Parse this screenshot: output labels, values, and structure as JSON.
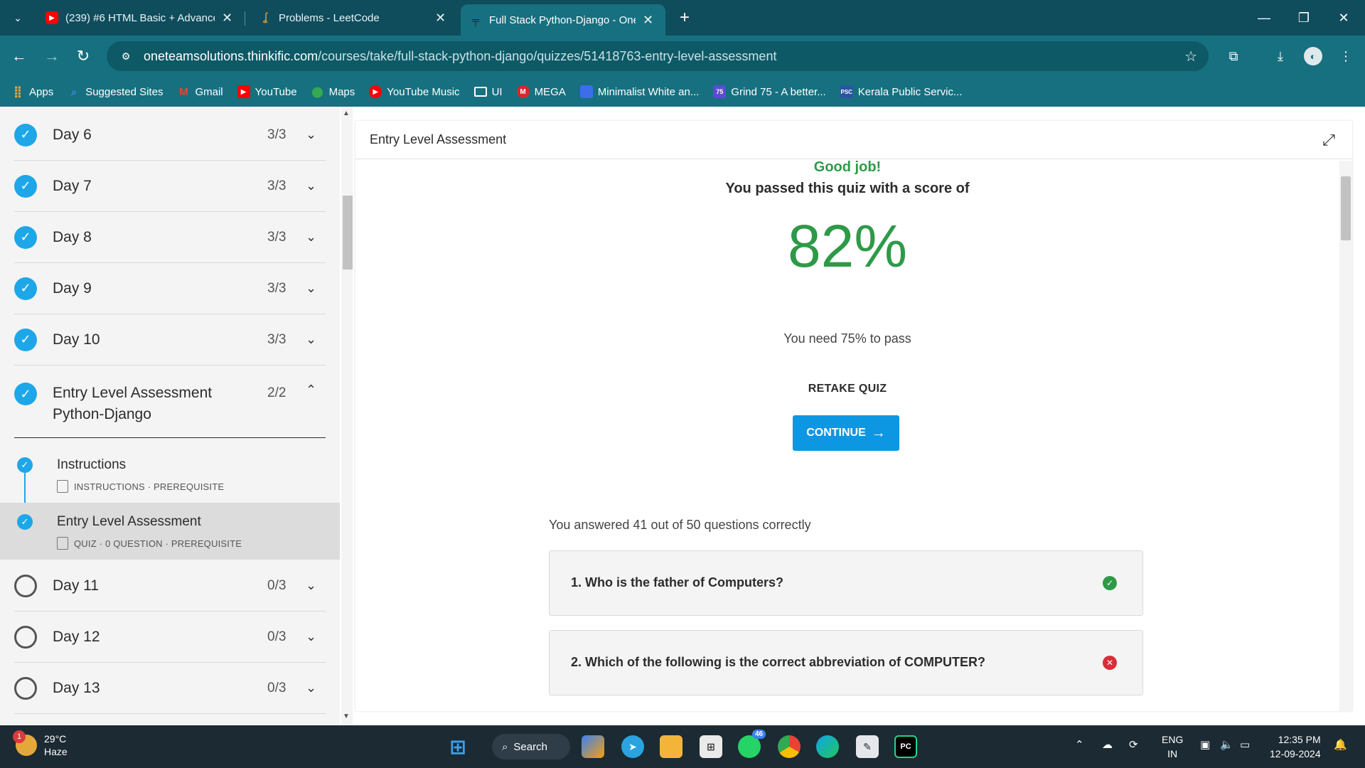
{
  "browser": {
    "tabs": [
      {
        "title": "(239) #6 HTML Basic + Advance",
        "favicon": "youtube-icon",
        "color": "#ff0000"
      },
      {
        "title": "Problems - LeetCode",
        "favicon": "leetcode-icon",
        "color": "#f0a23a"
      },
      {
        "title": "Full Stack Python-Django - One",
        "favicon": "thinkific-icon",
        "color": "#333333",
        "active": true
      }
    ],
    "url_domain": "oneteamsolutions.thinkific.com",
    "url_path": "/courses/take/full-stack-python-django/quizzes/51418763-entry-level-assessment",
    "bookmarks": [
      {
        "label": "Apps",
        "icon": "apps-grid-icon",
        "color": "#e8a33a"
      },
      {
        "label": "Suggested Sites",
        "icon": "suggested-icon",
        "color": "#3a8fd8"
      },
      {
        "label": "Gmail",
        "icon": "gmail-icon",
        "color": "#ea4335"
      },
      {
        "label": "YouTube",
        "icon": "youtube-icon",
        "color": "#ff0000"
      },
      {
        "label": "Maps",
        "icon": "maps-icon",
        "color": "#34a853"
      },
      {
        "label": "YouTube Music",
        "icon": "youtube-music-icon",
        "color": "#ff0000"
      },
      {
        "label": "UI",
        "icon": "folder-icon",
        "color": "#17707f"
      },
      {
        "label": "MEGA",
        "icon": "mega-icon",
        "color": "#d9272e"
      },
      {
        "label": "Minimalist White an...",
        "icon": "page-icon",
        "color": "#3b6ee8"
      },
      {
        "label": "Grind 75 - A better...",
        "icon": "grind75-icon",
        "color": "#5b4bd6"
      },
      {
        "label": "Kerala Public Servic...",
        "icon": "kpsc-icon",
        "color": "#2a55a0"
      }
    ]
  },
  "sidebar": {
    "days_top": [
      {
        "title": "Day 6",
        "count": "3/3"
      },
      {
        "title": "Day 7",
        "count": "3/3"
      },
      {
        "title": "Day 8",
        "count": "3/3"
      },
      {
        "title": "Day 9",
        "count": "3/3"
      },
      {
        "title": "Day 10",
        "count": "3/3"
      }
    ],
    "section": {
      "title_line1": "Entry Level Assessment",
      "title_line2": "Python-Django",
      "count": "2/2"
    },
    "lessons": [
      {
        "title": "Instructions",
        "meta": "INSTRUCTIONS · PREREQUISITE"
      },
      {
        "title": "Entry Level Assessment",
        "meta": "QUIZ · 0 QUESTION · PREREQUISITE"
      }
    ],
    "days_bottom": [
      {
        "title": "Day 11",
        "count": "0/3"
      },
      {
        "title": "Day 12",
        "count": "0/3"
      },
      {
        "title": "Day 13",
        "count": "0/3"
      }
    ]
  },
  "main": {
    "title": "Entry Level Assessment",
    "good_job": "Good job!",
    "passed_text": "You passed this quiz with a score of",
    "score": "82%",
    "pass_requirement": "You need 75% to pass",
    "retake_label": "RETAKE QUIZ",
    "continue_label": "CONTINUE",
    "answered_text": "You answered 41 out of 50 questions correctly",
    "questions": [
      {
        "text": "1. Who is the father of Computers?",
        "status": "correct",
        "color": "#2e9a48"
      },
      {
        "text": "2. Which of the following is the correct abbreviation of COMPUTER?",
        "status": "incorrect",
        "color": "#d92d3a"
      }
    ]
  },
  "taskbar": {
    "weather_temp": "29°C",
    "weather_desc": "Haze",
    "weather_badge": "1",
    "search_label": "Search",
    "whatsapp_badge": "46",
    "lang_line1": "ENG",
    "lang_line2": "IN",
    "time": "12:35 PM",
    "date": "12-09-2024"
  }
}
